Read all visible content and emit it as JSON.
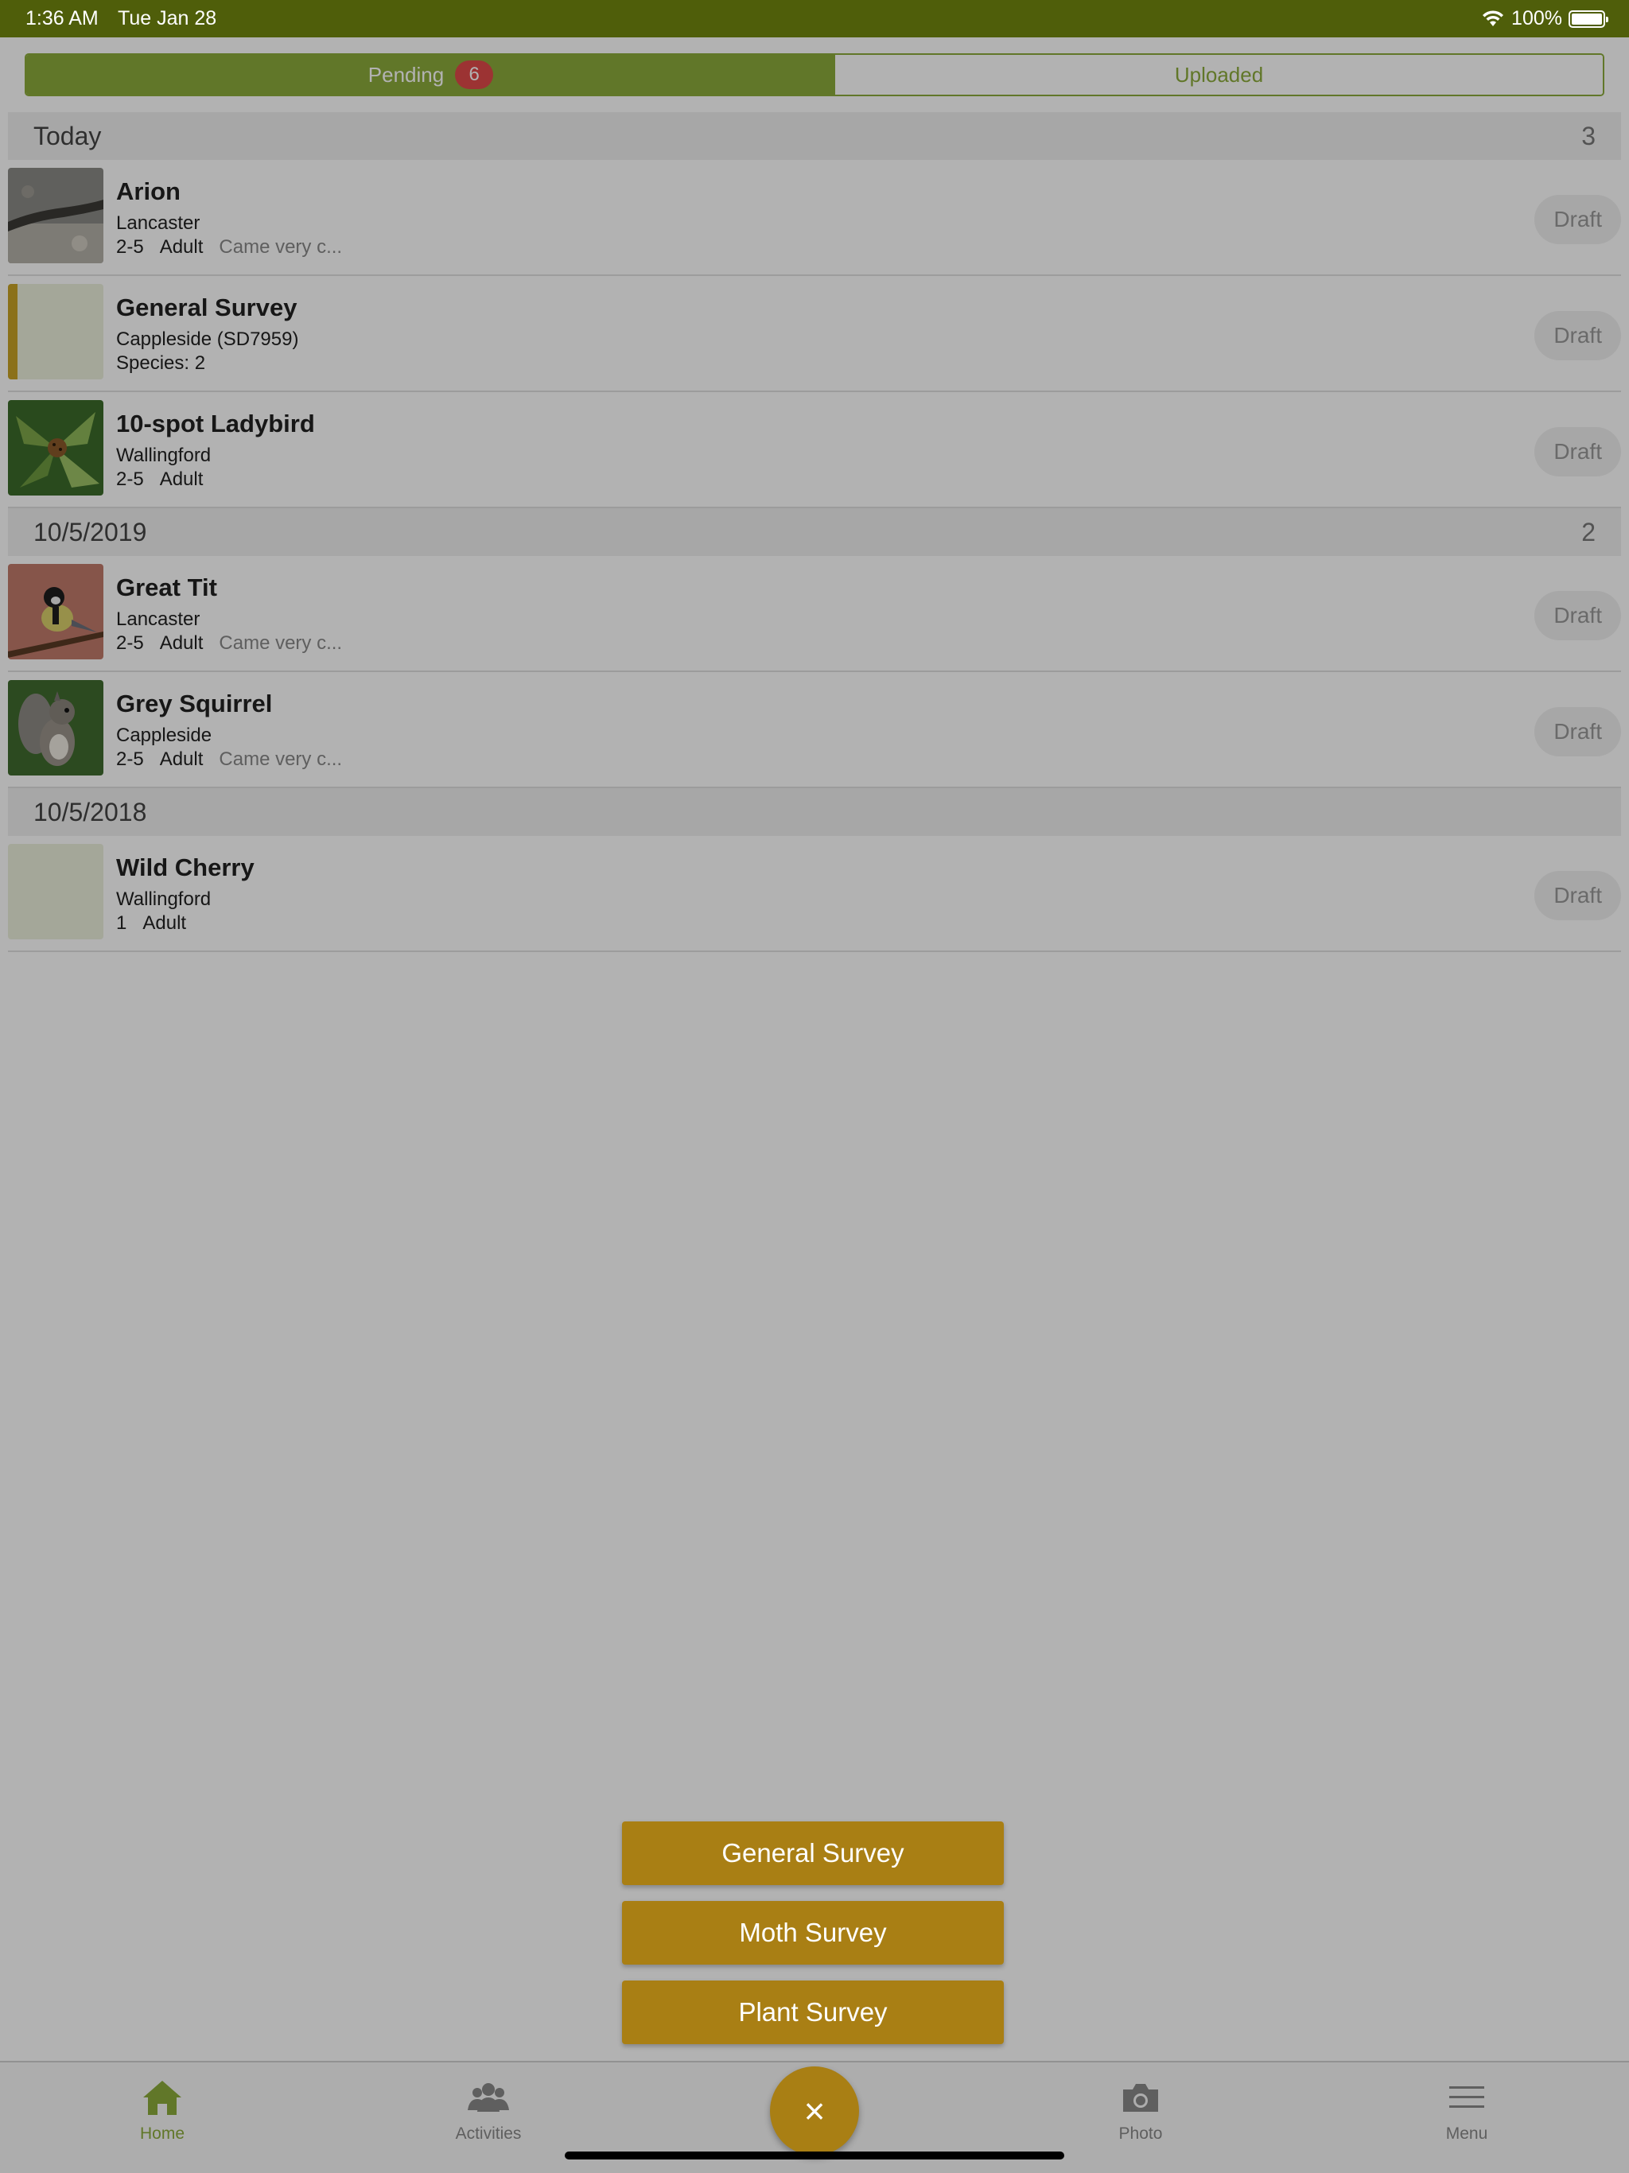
{
  "status_bar": {
    "time": "1:36 AM",
    "date": "Tue Jan 28",
    "battery": "100%"
  },
  "segment": {
    "pending_label": "Pending",
    "pending_count": "6",
    "uploaded_label": "Uploaded"
  },
  "groups": [
    {
      "label": "Today",
      "count": "3",
      "records": [
        {
          "title": "Arion",
          "location": "Lancaster",
          "count": "2-5",
          "stage": "Adult",
          "note": "Came very c...",
          "status": "Draft"
        },
        {
          "title": "General Survey",
          "location": "Cappleside (SD7959)",
          "species": "Species: 2",
          "status": "Draft"
        },
        {
          "title": "10-spot Ladybird",
          "location": "Wallingford",
          "count": "2-5",
          "stage": "Adult",
          "status": "Draft"
        }
      ]
    },
    {
      "label": "10/5/2019",
      "count": "2",
      "records": [
        {
          "title": "Great Tit",
          "location": "Lancaster",
          "count": "2-5",
          "stage": "Adult",
          "note": "Came very c...",
          "status": "Draft"
        },
        {
          "title": "Grey Squirrel",
          "location": "Cappleside",
          "count": "2-5",
          "stage": "Adult",
          "note": "Came very c...",
          "status": "Draft"
        }
      ]
    },
    {
      "label": "10/5/2018",
      "count": "",
      "records": [
        {
          "title": "Wild Cherry",
          "location": "Wallingford",
          "count": "1",
          "stage": "Adult",
          "status": "Draft"
        }
      ]
    }
  ],
  "fab_menu": {
    "general": "General Survey",
    "moth": "Moth Survey",
    "plant": "Plant Survey"
  },
  "fab": {
    "close_glyph": "×"
  },
  "tabbar": {
    "home": "Home",
    "activities": "Activities",
    "photo": "Photo",
    "menu": "Menu"
  },
  "colors": {
    "primary": "#8cab3c",
    "status_bar": "#4f5e0a",
    "accent": "#a97f14",
    "badge": "#e04a4a"
  }
}
